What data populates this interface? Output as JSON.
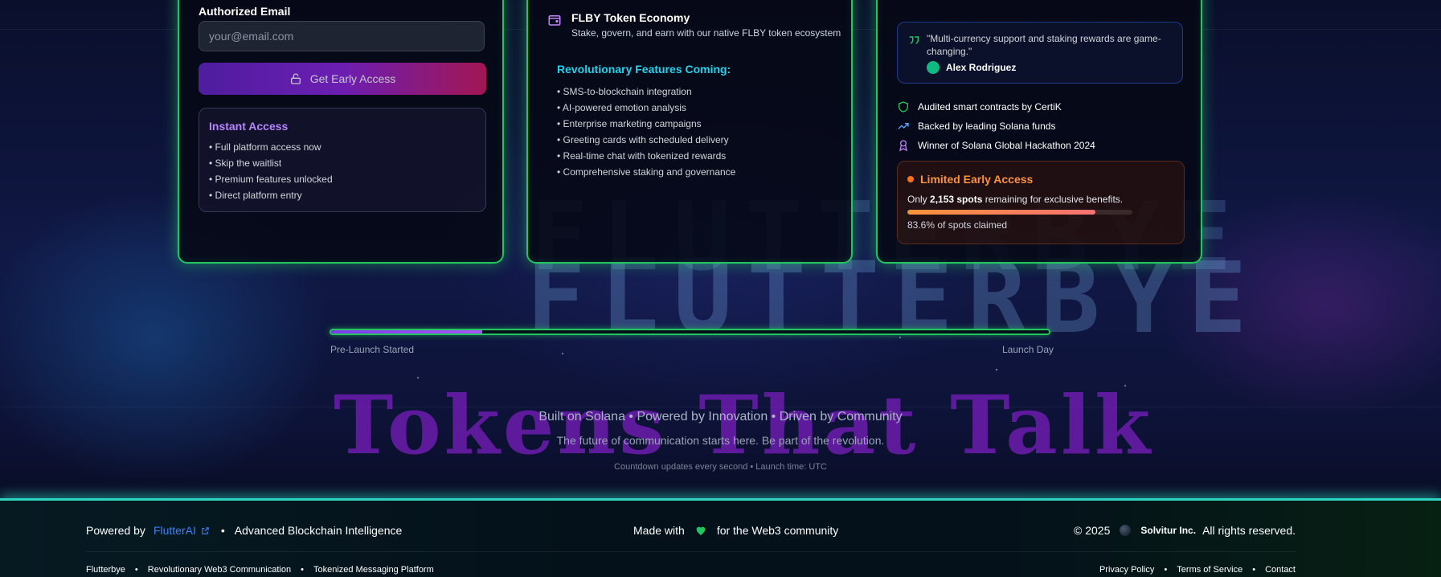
{
  "background": {
    "brand_word": "FLUTTERBYE",
    "tagline": "Tokens That Talk"
  },
  "left_card": {
    "email_label": "Authorized Email",
    "email_placeholder": "your@email.com",
    "access_button": "Get Early Access",
    "instant_title": "Instant Access",
    "instant_items": [
      "Full platform access now",
      "Skip the waitlist",
      "Premium features unlocked",
      "Direct platform entry"
    ]
  },
  "middle_card": {
    "flby_title": "FLBY Token Economy",
    "flby_desc": "Stake, govern, and earn with our native FLBY token ecosystem",
    "features_title": "Revolutionary Features Coming:",
    "features": [
      "SMS-to-blockchain integration",
      "AI-powered emotion analysis",
      "Enterprise marketing campaigns",
      "Greeting cards with scheduled delivery",
      "Real-time chat with tokenized rewards",
      "Comprehensive staking and governance"
    ]
  },
  "right_card": {
    "quote": "\"Multi-currency support and staking rewards are game-changing.\"",
    "quote_author": "Alex Rodriguez",
    "trust_items": [
      "Audited smart contracts by CertiK",
      "Backed by leading Solana funds",
      "Winner of Solana Global Hackathon 2024"
    ],
    "limited_title": "Limited Early Access",
    "spots_prefix": "Only ",
    "spots_count": "2,153 spots",
    "spots_suffix": " remaining for exclusive benefits.",
    "spots_claimed_percent": 83.6,
    "claimed_text": "83.6% of spots claimed"
  },
  "launch_progress": {
    "start_label": "Pre-Launch Started",
    "end_label": "Launch Day",
    "progress_fraction": 0.21
  },
  "bottom": {
    "line1": "Built on Solana • Powered by Innovation • Driven by Community",
    "line2": "The future of communication starts here. Be part of the revolution.",
    "line3": "Countdown updates every second • Launch time: UTC"
  },
  "footer": {
    "powered_by": "Powered by",
    "flutterai": "FlutterAI",
    "advanced": "Advanced Blockchain Intelligence",
    "made_with": "Made with",
    "for_community": "for the Web3 community",
    "copyright": "© 2025",
    "company": "Solvitur Inc.",
    "rights": "All rights reserved.",
    "links_left": [
      "Flutterbye",
      "Revolutionary Web3 Communication",
      "Tokenized Messaging Platform"
    ],
    "links_right": [
      "Privacy Policy",
      "Terms of Service",
      "Contact"
    ]
  },
  "colors": {
    "card_border": "#22c55e",
    "accent_cyan": "#22d3ee",
    "accent_purple": "#b784ff",
    "accent_orange": "#fb923c",
    "footer_glow": "#2dd4bf",
    "link_blue": "#3b82f6"
  }
}
